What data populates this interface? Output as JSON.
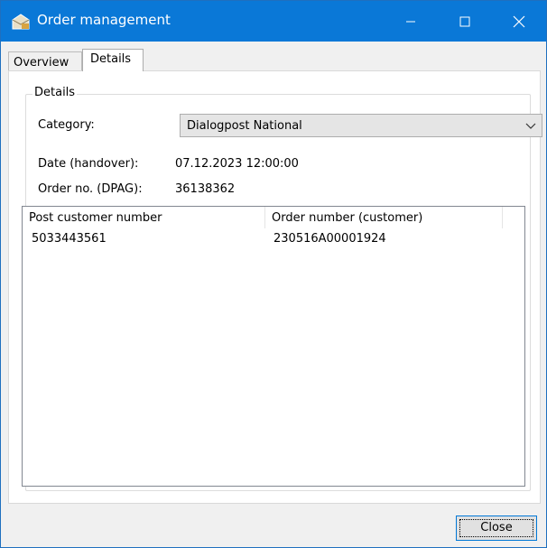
{
  "window": {
    "title": "Order management",
    "app_icon": "folder-envelope-icon",
    "controls": [
      "minimize-icon",
      "maximize-icon",
      "close-icon"
    ]
  },
  "tabs": [
    {
      "label": "Overview",
      "selected": false
    },
    {
      "label": "Details",
      "selected": true
    }
  ],
  "details": {
    "group_title": "Details",
    "category_label": "Category:",
    "category_value": "Dialogpost National",
    "date_label": "Date (handover):",
    "date_value": "07.12.2023 12:00:00",
    "order_label": "Order no. (DPAG):",
    "order_value": "36138362"
  },
  "list": {
    "columns": [
      "Post customer number",
      "Order number (customer)"
    ],
    "rows": [
      [
        "5033443561",
        "230516A00001924"
      ]
    ]
  },
  "footer": {
    "close_label": "Close"
  },
  "colors": {
    "titlebar": "#0a78d7",
    "window_bg": "#f0f0f0",
    "button_focus_border": "#0078d7"
  }
}
